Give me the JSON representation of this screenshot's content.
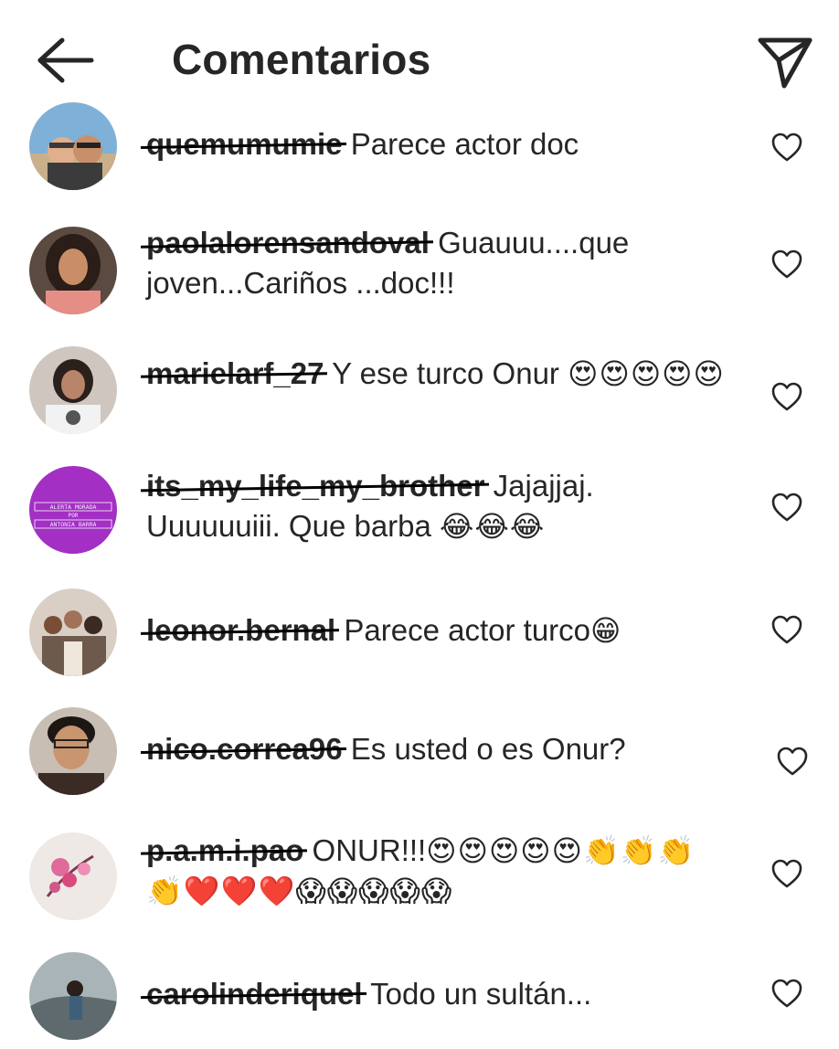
{
  "header": {
    "title": "Comentarios",
    "back_icon": "arrow-left-icon",
    "share_icon": "paper-plane-icon"
  },
  "comments": [
    {
      "username": "quemumumie",
      "text": "Parece actor doc",
      "emoji": ""
    },
    {
      "username": "paolalorensandoval",
      "text": "Guauuu....que joven...Cariños ...doc!!!",
      "emoji": ""
    },
    {
      "username": "marielarf_27",
      "text": "Y ese turco Onur",
      "emoji": "😍😍😍😍😍"
    },
    {
      "username": "its_my_life_my_brother",
      "text": "Jajajjaj. Uuuuuuiii. Que barba",
      "emoji": "😂😂😂"
    },
    {
      "username": "leonor.bernal",
      "text": "Parece actor turco",
      "emoji": "😁"
    },
    {
      "username": "nico.correa96",
      "text": "Es usted o es Onur?",
      "emoji": ""
    },
    {
      "username": "p.a.m.i.pao",
      "text": "ONUR!!!",
      "emoji": "😍😍😍😍😍👏👏👏👏❤️❤️❤️😱😱😱😱😱"
    },
    {
      "username": "carolinderiquel",
      "text": "Todo un sultán...",
      "emoji": ""
    }
  ],
  "avatar_logo": {
    "line1": "ALERTA MORADA",
    "line2": "POR",
    "line3": "ANTONIA BARRA"
  },
  "colors": {
    "text": "#262626",
    "icon": "#262626",
    "strike": "#000000",
    "purple_avatar": "#a32fc4"
  }
}
